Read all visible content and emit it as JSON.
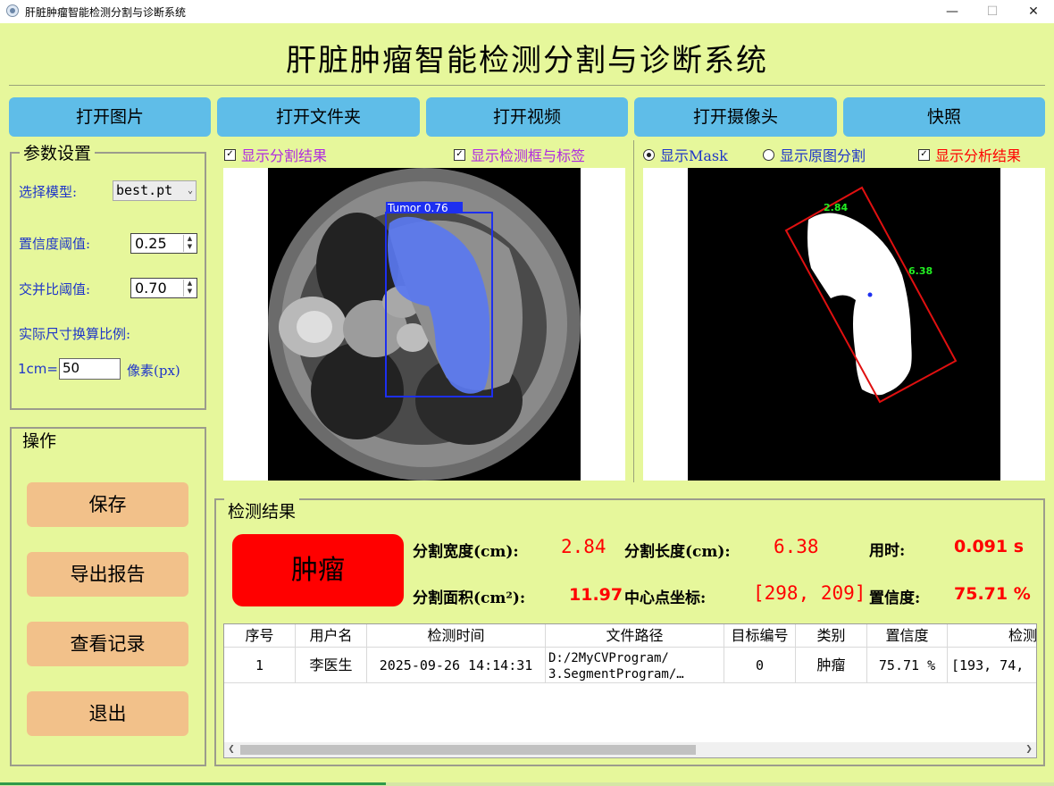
{
  "window": {
    "title": "肝脏肿瘤智能检测分割与诊断系统",
    "controls": {
      "minimize": "—",
      "maximize": "☐",
      "close": "✕"
    }
  },
  "header": {
    "title": "肝脏肿瘤智能检测分割与诊断系统"
  },
  "toolbar": {
    "open_image": "打开图片",
    "open_folder": "打开文件夹",
    "open_video": "打开视频",
    "open_camera": "打开摄像头",
    "snapshot": "快照"
  },
  "params": {
    "title": "参数设置",
    "model_label": "选择模型:",
    "model_value": "best.pt",
    "conf_label": "置信度阈值:",
    "conf_value": "0.25",
    "iou_label": "交并比阈值:",
    "iou_value": "0.70",
    "scale_label": "实际尺寸换算比例:",
    "cm_label": "1cm=",
    "px_value": "50",
    "px_unit": "像素(px)"
  },
  "operations": {
    "title": "操作",
    "save": "保存",
    "export_report": "导出报告",
    "view_records": "查看记录",
    "exit": "退出"
  },
  "left_view": {
    "show_seg": {
      "label": "显示分割结果",
      "checked": true
    },
    "show_box": {
      "label": "显示检测框与标签",
      "checked": true
    },
    "detection_label": "Tumor 0.76"
  },
  "right_view": {
    "show_mask": {
      "label": "显示Mask",
      "selected": true
    },
    "show_original_seg": {
      "label": "显示原图分割",
      "selected": false
    },
    "show_analysis": {
      "label": "显示分析结果",
      "checked": true
    },
    "width_annotation": "2.84",
    "length_annotation": "6.38"
  },
  "results": {
    "title": "检测结果",
    "class_name": "肿瘤",
    "width_label": "分割宽度(cm):",
    "width_value": "2.84",
    "length_label": "分割长度(cm):",
    "length_value": "6.38",
    "time_label": "用时:",
    "time_value": "0.091 s",
    "area_label": "分割面积(cm²):",
    "area_value": "11.97",
    "center_label": "中心点坐标:",
    "center_value": "[298, 209]",
    "conf_label": "置信度:",
    "conf_value": "75.71 %"
  },
  "table": {
    "headers": [
      "序号",
      "用户名",
      "检测时间",
      "文件路径",
      "目标编号",
      "类别",
      "置信度",
      "检测"
    ],
    "rows": [
      {
        "index": "1",
        "user": "李医生",
        "time": "2025-09-26 14:14:31",
        "path_line1": "D:/2MyCVProgram/",
        "path_line2": "3.SegmentProgram/…",
        "target_id": "0",
        "category": "肿瘤",
        "confidence": "75.71 %",
        "box": "[193, 74,"
      }
    ]
  },
  "colors": {
    "background": "#e6f79b",
    "toolbar_button": "#5fbde8",
    "operation_button": "#f2c18a",
    "class_badge": "#ff0000",
    "label_blue": "#1f36c8",
    "checkbox_text": "#b02be0",
    "mask_blue": "#5a78f0",
    "analysis_red": "#ff0000"
  }
}
